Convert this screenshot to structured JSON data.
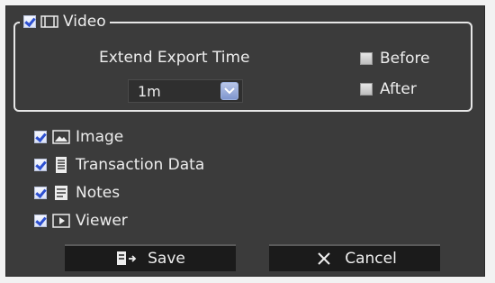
{
  "video_group": {
    "label": "Video",
    "checked": true,
    "extend_label": "Extend Export Time",
    "duration_selected": "1m",
    "before_label": "Before",
    "before_checked": false,
    "after_label": "After",
    "after_checked": false
  },
  "items": [
    {
      "label": "Image",
      "checked": true,
      "icon": "image-icon"
    },
    {
      "label": "Transaction Data",
      "checked": true,
      "icon": "transaction-data-icon"
    },
    {
      "label": "Notes",
      "checked": true,
      "icon": "notes-icon"
    },
    {
      "label": "Viewer",
      "checked": true,
      "icon": "viewer-icon"
    }
  ],
  "buttons": {
    "save_label": "Save",
    "cancel_label": "Cancel"
  },
  "colors": {
    "panel_bg": "#3b3b3b",
    "checkmark": "#2c4fd0",
    "button_bg": "#1b1b1b",
    "text": "#ededed"
  }
}
